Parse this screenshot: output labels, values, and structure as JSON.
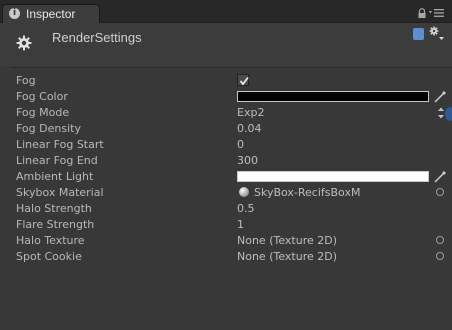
{
  "tab": {
    "label": "Inspector"
  },
  "header": {
    "title": "RenderSettings"
  },
  "colors": {
    "fog_color": "#000000",
    "ambient_light": "#ffffff"
  },
  "icons": {
    "tab": "info-icon",
    "lock": "lock-icon",
    "menu": "tab-menu-icon",
    "component": "cog-icon",
    "help": "help-icon",
    "settings": "settings-icon"
  },
  "properties": {
    "fog": {
      "label": "Fog",
      "checked": true
    },
    "fog_color": {
      "label": "Fog Color"
    },
    "fog_mode": {
      "label": "Fog Mode",
      "value": "Exp2"
    },
    "fog_density": {
      "label": "Fog Density",
      "value": "0.04"
    },
    "linear_fog_start": {
      "label": "Linear Fog Start",
      "value": "0"
    },
    "linear_fog_end": {
      "label": "Linear Fog End",
      "value": "300"
    },
    "ambient_light": {
      "label": "Ambient Light"
    },
    "skybox_material": {
      "label": "Skybox Material",
      "value": "SkyBox-RecifsBoxM"
    },
    "halo_strength": {
      "label": "Halo Strength",
      "value": "0.5"
    },
    "flare_strength": {
      "label": "Flare Strength",
      "value": "1"
    },
    "halo_texture": {
      "label": "Halo Texture",
      "value": "None (Texture 2D)"
    },
    "spot_cookie": {
      "label": "Spot Cookie",
      "value": "None (Texture 2D)"
    }
  }
}
